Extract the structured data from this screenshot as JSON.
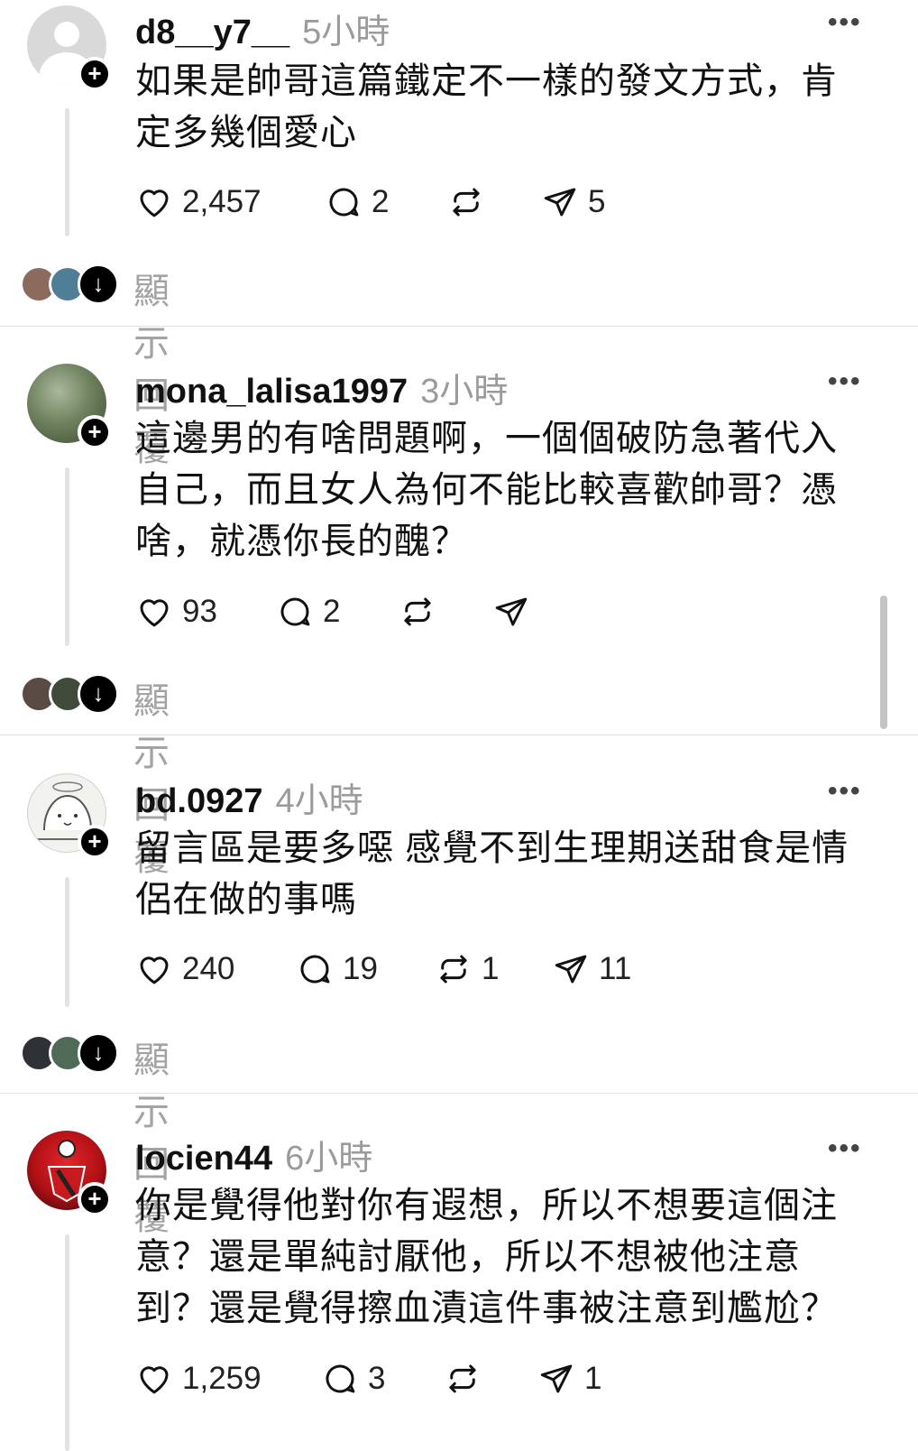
{
  "posts": [
    {
      "username": "d8__y7__",
      "time": "5小時",
      "lines": [
        "如果是帥哥這篇鐵定不一樣的發文方式，肯",
        "定多幾個愛心"
      ],
      "likes": "2,457",
      "comments": "2",
      "reposts": "",
      "shares": "5",
      "show_replies": "顯示回覆",
      "avatar_style": "default-avatar"
    },
    {
      "username": "mona_lalisa1997",
      "time": "3小時",
      "lines": [
        "這邊男的有啥問題啊，一個個破防急著代入",
        "自己，而且女人為何不能比較喜歡帥哥？憑",
        "啥，就憑你長的醜？"
      ],
      "likes": "93",
      "comments": "2",
      "reposts": "",
      "shares": "",
      "show_replies": "顯示回覆",
      "avatar_style": "forest-photo"
    },
    {
      "username": "bd.0927",
      "time": "4小時",
      "lines": [
        "留言區是要多噁 感覺不到生理期送甜食是情",
        "侶在做的事嗎"
      ],
      "likes": "240",
      "comments": "19",
      "reposts": "1",
      "shares": "11",
      "show_replies": "顯示回覆",
      "avatar_style": "sketch-drawing"
    },
    {
      "username": "locien44",
      "time": "6小時",
      "lines": [
        "你是覺得他對你有遐想，所以不想要這個注",
        "意？還是單純討厭他，所以不想被他注意",
        "到？還是覺得擦血漬這件事被注意到尷尬？"
      ],
      "likes": "1,259",
      "comments": "3",
      "reposts": "",
      "shares": "1",
      "show_replies": "",
      "avatar_style": "red-badge"
    }
  ],
  "icons": {
    "like": "heart-icon",
    "comment": "comment-bubble-icon",
    "repost": "repost-icon",
    "share": "send-icon",
    "more": "more-dots-icon",
    "follow": "plus-icon",
    "expand": "arrow-down-icon"
  },
  "more_glyph": "•••",
  "plus_glyph": "+",
  "down_glyph": "↓"
}
